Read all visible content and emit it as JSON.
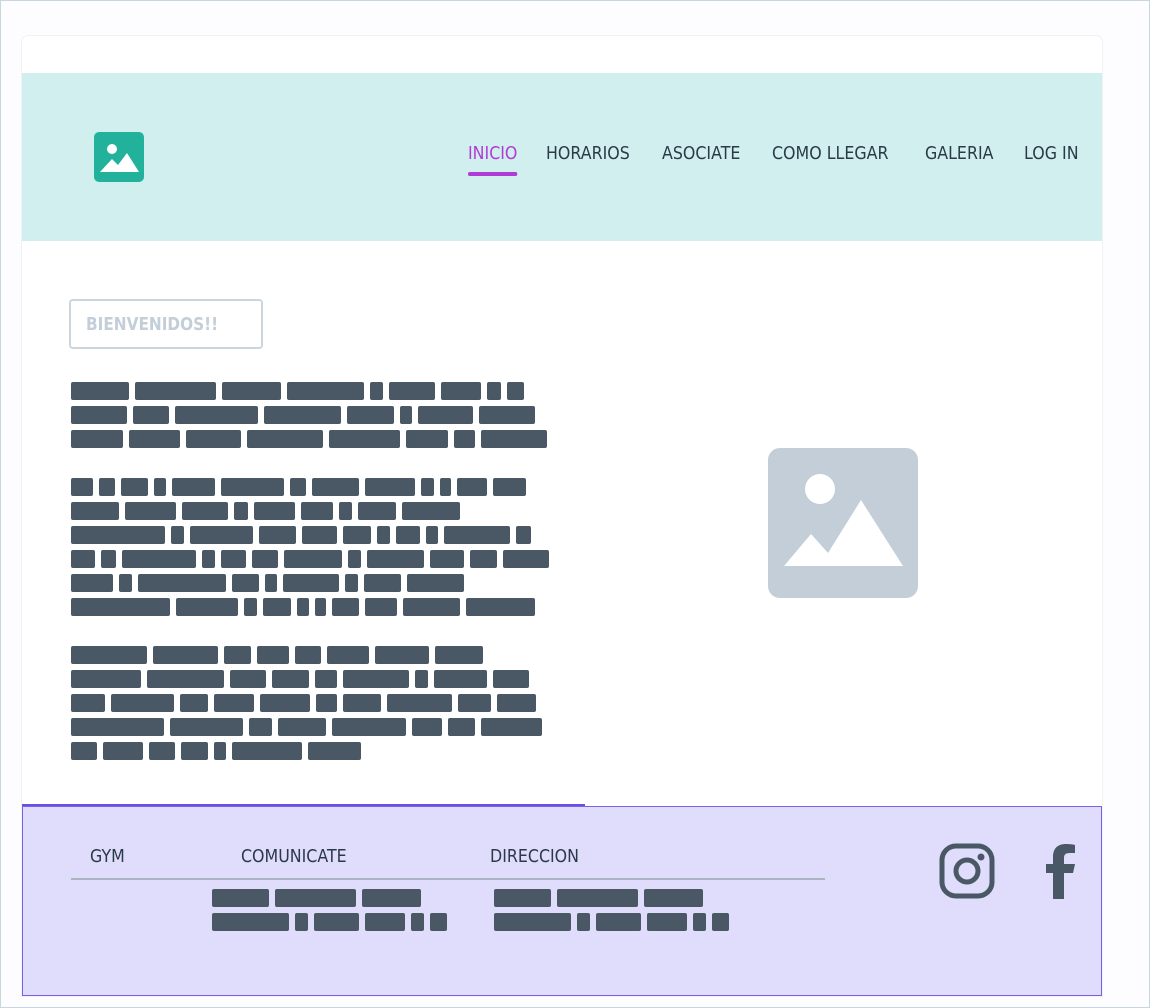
{
  "nav": {
    "items": [
      {
        "label": "INICIO",
        "active": true
      },
      {
        "label": "HORARIOS",
        "active": false
      },
      {
        "label": "ASOCIATE",
        "active": false
      },
      {
        "label": "COMO LLEGAR",
        "active": false
      },
      {
        "label": "GALERIA",
        "active": false
      },
      {
        "label": "LOG IN",
        "active": false
      }
    ]
  },
  "main": {
    "welcome_label": "BIENVENIDOS!!"
  },
  "footer": {
    "col1_heading": "GYM",
    "col2_heading": "COMUNICATE",
    "col3_heading": "DIRECCION"
  },
  "icons": {
    "logo": "image-icon",
    "hero": "image-placeholder-icon",
    "social": [
      "instagram-icon",
      "facebook-icon"
    ]
  },
  "colors": {
    "header_bg": "#d1efee",
    "accent": "#b13bd6",
    "logo": "#22b29c",
    "footer_bg": "#dfdcfc",
    "redacted_text": "#4a5866"
  }
}
